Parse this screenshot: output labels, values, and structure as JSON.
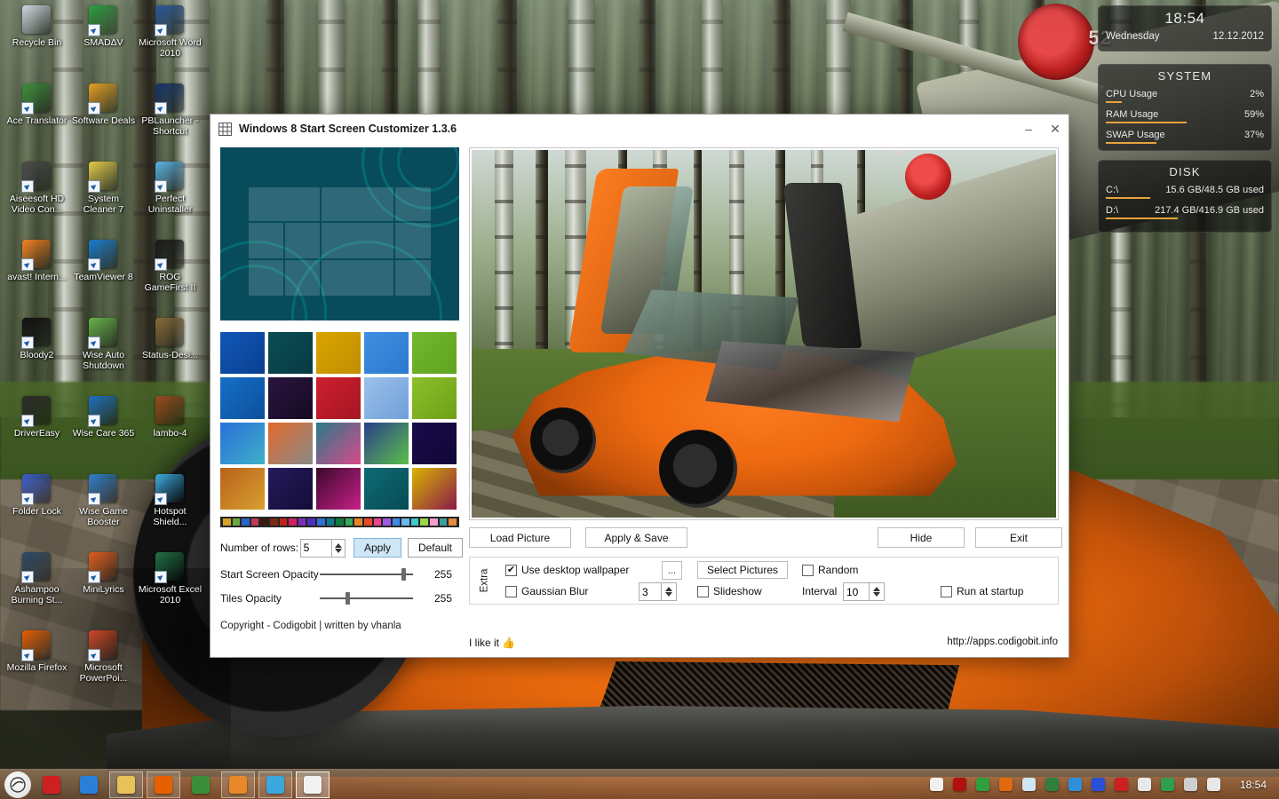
{
  "desktop": {
    "icons": [
      {
        "label": "Recycle Bin",
        "icon": "recycle-bin-icon",
        "shortcut": false,
        "color": "#cfd8e3"
      },
      {
        "label": "SMADΔV",
        "icon": "smadav-icon",
        "shortcut": true,
        "color": "#2e9e3f"
      },
      {
        "label": "Microsoft Word 2010",
        "icon": "word-icon",
        "shortcut": true,
        "color": "#2a5699"
      },
      {
        "label": "Ace Translator",
        "icon": "ace-translator-icon",
        "shortcut": true,
        "color": "#3b8f3b"
      },
      {
        "label": "Software Deals",
        "icon": "software-deals-icon",
        "shortcut": true,
        "color": "#e8a020"
      },
      {
        "label": "PBLauncher - Shortcut",
        "icon": "pblauncher-icon",
        "shortcut": true,
        "color": "#17356b"
      },
      {
        "label": "Aiseesoft HD Video Con...",
        "icon": "aiseesoft-icon",
        "shortcut": true,
        "color": "#4a4a4a"
      },
      {
        "label": "System Cleaner 7",
        "icon": "system-cleaner-icon",
        "shortcut": true,
        "color": "#e8cf49"
      },
      {
        "label": "Perfect Uninstaller",
        "icon": "perfect-uninstaller-icon",
        "shortcut": true,
        "color": "#5ab3e8"
      },
      {
        "label": "avast! Intern...",
        "icon": "avast-icon",
        "shortcut": true,
        "color": "#f58220"
      },
      {
        "label": "TeamViewer 8",
        "icon": "teamviewer-icon",
        "shortcut": true,
        "color": "#1a7fd4"
      },
      {
        "label": "ROG GameFirst II",
        "icon": "rog-gamefirst-icon",
        "shortcut": true,
        "color": "#1c1c1c"
      },
      {
        "label": "Bloody2",
        "icon": "bloody2-icon",
        "shortcut": true,
        "color": "#101010"
      },
      {
        "label": "Wise Auto Shutdown",
        "icon": "wise-auto-shutdown-icon",
        "shortcut": true,
        "color": "#68b84b"
      },
      {
        "label": "Status-Desi...",
        "icon": "status-desi-image-icon",
        "shortcut": false,
        "color": "#8a6a3a"
      },
      {
        "label": "DriverEasy",
        "icon": "drivereasy-icon",
        "shortcut": true,
        "color": "#2b2b2b"
      },
      {
        "label": "Wise Care 365",
        "icon": "wise-care-365-icon",
        "shortcut": true,
        "color": "#1f6fc4"
      },
      {
        "label": "lambo-4",
        "icon": "lambo-4-image-icon",
        "shortcut": false,
        "color": "#9b4a1e"
      },
      {
        "label": "Folder Lock",
        "icon": "folder-lock-icon",
        "shortcut": true,
        "color": "#3c5fd0"
      },
      {
        "label": "Wise Game Booster",
        "icon": "wise-game-booster-icon",
        "shortcut": true,
        "color": "#2f7fd0"
      },
      {
        "label": "Hotspot Shield...",
        "icon": "hotspot-shield-icon",
        "shortcut": true,
        "color": "#3aa8dd"
      },
      {
        "label": "Ashampoo Burning St...",
        "icon": "ashampoo-burning-studio-icon",
        "shortcut": true,
        "color": "#2c4a66"
      },
      {
        "label": "MiniLyrics",
        "icon": "minilyrics-icon",
        "shortcut": true,
        "color": "#e05a1a"
      },
      {
        "label": "Microsoft Excel 2010",
        "icon": "excel-icon",
        "shortcut": true,
        "color": "#217346"
      },
      {
        "label": "Mozilla Firefox",
        "icon": "firefox-icon",
        "shortcut": true,
        "color": "#e66000"
      },
      {
        "label": "Microsoft PowerPoi...",
        "icon": "powerpoint-icon",
        "shortcut": true,
        "color": "#d24726"
      }
    ]
  },
  "widget": {
    "clock": {
      "time": "18:54",
      "day": "Wednesday",
      "date": "12.12.2012"
    },
    "system": {
      "title": "SYSTEM",
      "rows": [
        {
          "label": "CPU Usage",
          "value": "2%",
          "pct": 2
        },
        {
          "label": "RAM Usage",
          "value": "59%",
          "pct": 59
        },
        {
          "label": "SWAP Usage",
          "value": "37%",
          "pct": 37
        }
      ]
    },
    "disk": {
      "title": "DISK",
      "rows": [
        {
          "label": "C:\\",
          "value": "15.6 GB/48.5 GB used",
          "pct": 32
        },
        {
          "label": "D:\\",
          "value": "217.4 GB/416.9 GB used",
          "pct": 52
        }
      ]
    }
  },
  "window": {
    "title": "Windows 8 Start Screen Customizer 1.3.6",
    "minimize_label": "–",
    "close_label": "✕",
    "accent_color": "#084c5c"
  },
  "left_panel": {
    "palette": [
      "#d8a22b",
      "#6aa83c",
      "#2b64c8",
      "#c03a5a",
      "#3a1a10",
      "#7a2a12",
      "#c41f1f",
      "#cf2060",
      "#7b2fbd",
      "#4c2fbd",
      "#2f6fd8",
      "#0f7a8f",
      "#0e7a3c",
      "#36a85a",
      "#e8842a",
      "#e84a2a",
      "#e8468a",
      "#9b5ae8",
      "#3a8ae8",
      "#66b8f0",
      "#3ec8c8",
      "#9bd84a",
      "#f0a0c8",
      "#3a9e9e",
      "#e8883a"
    ],
    "rows_label": "Number of rows:",
    "rows_value": "5",
    "apply_label": "Apply",
    "default_label": "Default",
    "sliders": [
      {
        "label": "Start Screen Opacity",
        "value": "255",
        "pos": 88
      },
      {
        "label": "Tiles Opacity",
        "value": "255",
        "pos": 28
      }
    ],
    "copyright": "Copyright - Codigobit | written by vhanla",
    "thumbnails": [
      {
        "name": "thumb-1",
        "bg": "linear-gradient(135deg,#1057b8,#0a3f8f)"
      },
      {
        "name": "thumb-2",
        "bg": "linear-gradient(135deg,#0b4d55,#073a42)"
      },
      {
        "name": "thumb-3",
        "bg": "linear-gradient(135deg,#d9a400,#c08e00)"
      },
      {
        "name": "thumb-4",
        "bg": "linear-gradient(135deg,#3f8fe0,#2a79d0)"
      },
      {
        "name": "thumb-5",
        "bg": "linear-gradient(135deg,#74b82e,#5fa320)"
      },
      {
        "name": "thumb-6",
        "bg": "linear-gradient(135deg,#1470c8,#0d4f9b)"
      },
      {
        "name": "thumb-7",
        "bg": "linear-gradient(135deg,#2a1540,#150a22)"
      },
      {
        "name": "thumb-8",
        "bg": "linear-gradient(135deg,#cf2030,#a41522)"
      },
      {
        "name": "thumb-9",
        "bg": "linear-gradient(135deg,#9cc0ea,#6f9fd8)"
      },
      {
        "name": "thumb-10",
        "bg": "linear-gradient(135deg,#8cbf2a,#6fa018)"
      },
      {
        "name": "thumb-11",
        "bg": "linear-gradient(135deg,#2a6fd8,#3fb0c8)"
      },
      {
        "name": "thumb-12",
        "bg": "linear-gradient(135deg,#e06a2a,#8a8a8a)"
      },
      {
        "name": "thumb-13",
        "bg": "linear-gradient(135deg,#2a7a8a,#d84a8a)"
      },
      {
        "name": "thumb-14",
        "bg": "linear-gradient(135deg,#2a3f8a,#5abf4a)"
      },
      {
        "name": "thumb-15",
        "bg": "linear-gradient(135deg,#1a0a4a,#120736)"
      },
      {
        "name": "thumb-16",
        "bg": "linear-gradient(135deg,#b8601a,#d8a030)"
      },
      {
        "name": "thumb-17",
        "bg": "linear-gradient(135deg,#251a5c,#140d36)"
      },
      {
        "name": "thumb-18",
        "bg": "linear-gradient(135deg,#3a0a2a,#c81f8a)"
      },
      {
        "name": "thumb-19",
        "bg": "linear-gradient(135deg,#0d6a74,#084c55)"
      },
      {
        "name": "thumb-20",
        "bg": "linear-gradient(135deg,#d8b400,#8a1a4a)"
      }
    ]
  },
  "right_panel": {
    "load_picture_label": "Load Picture",
    "apply_save_label": "Apply & Save",
    "hide_label": "Hide",
    "exit_label": "Exit",
    "extra_tab_label": "Extra",
    "use_desktop_wallpaper_label": "Use desktop wallpaper",
    "use_desktop_wallpaper_checked": true,
    "browse_label": "...",
    "gaussian_blur_label": "Gaussian Blur",
    "gaussian_blur_checked": false,
    "gaussian_blur_value": "3",
    "select_pictures_label": "Select Pictures",
    "random_label": "Random",
    "random_checked": false,
    "slideshow_label": "Slideshow",
    "slideshow_checked": false,
    "interval_label": "Interval",
    "interval_value": "10",
    "run_at_startup_label": "Run at startup",
    "run_at_startup_checked": false,
    "like_label": "I like it",
    "like_icon": "thumbs-up-icon",
    "link": "http://apps.codigobit.info"
  },
  "taskbar": {
    "start_icon": "start-orb-icon",
    "items": [
      {
        "name": "angry-birds-icon",
        "open": false
      },
      {
        "name": "internet-explorer-icon",
        "open": false
      },
      {
        "name": "file-explorer-icon",
        "open": true
      },
      {
        "name": "firefox-icon",
        "open": true
      },
      {
        "name": "ace-translator-icon",
        "open": false
      },
      {
        "name": "music-player-icon",
        "open": true
      },
      {
        "name": "media-player-icon",
        "open": true
      },
      {
        "name": "start-screen-customizer-icon",
        "open": true,
        "active": true
      }
    ],
    "tray": [
      "start-screen-customizer-tray-icon",
      "bloody2-tray-icon",
      "smadav-tray-icon",
      "ashampoo-tray-icon",
      "water-drop-tray-icon",
      "ace-translator-tray-icon",
      "idm-tray-icon",
      "hotspot-shield-tray-icon",
      "folder-lock-tray-icon",
      "flag-action-center-icon",
      "clock-tray-icon",
      "network-tray-icon",
      "volume-tray-icon"
    ],
    "clock": "18:54"
  }
}
